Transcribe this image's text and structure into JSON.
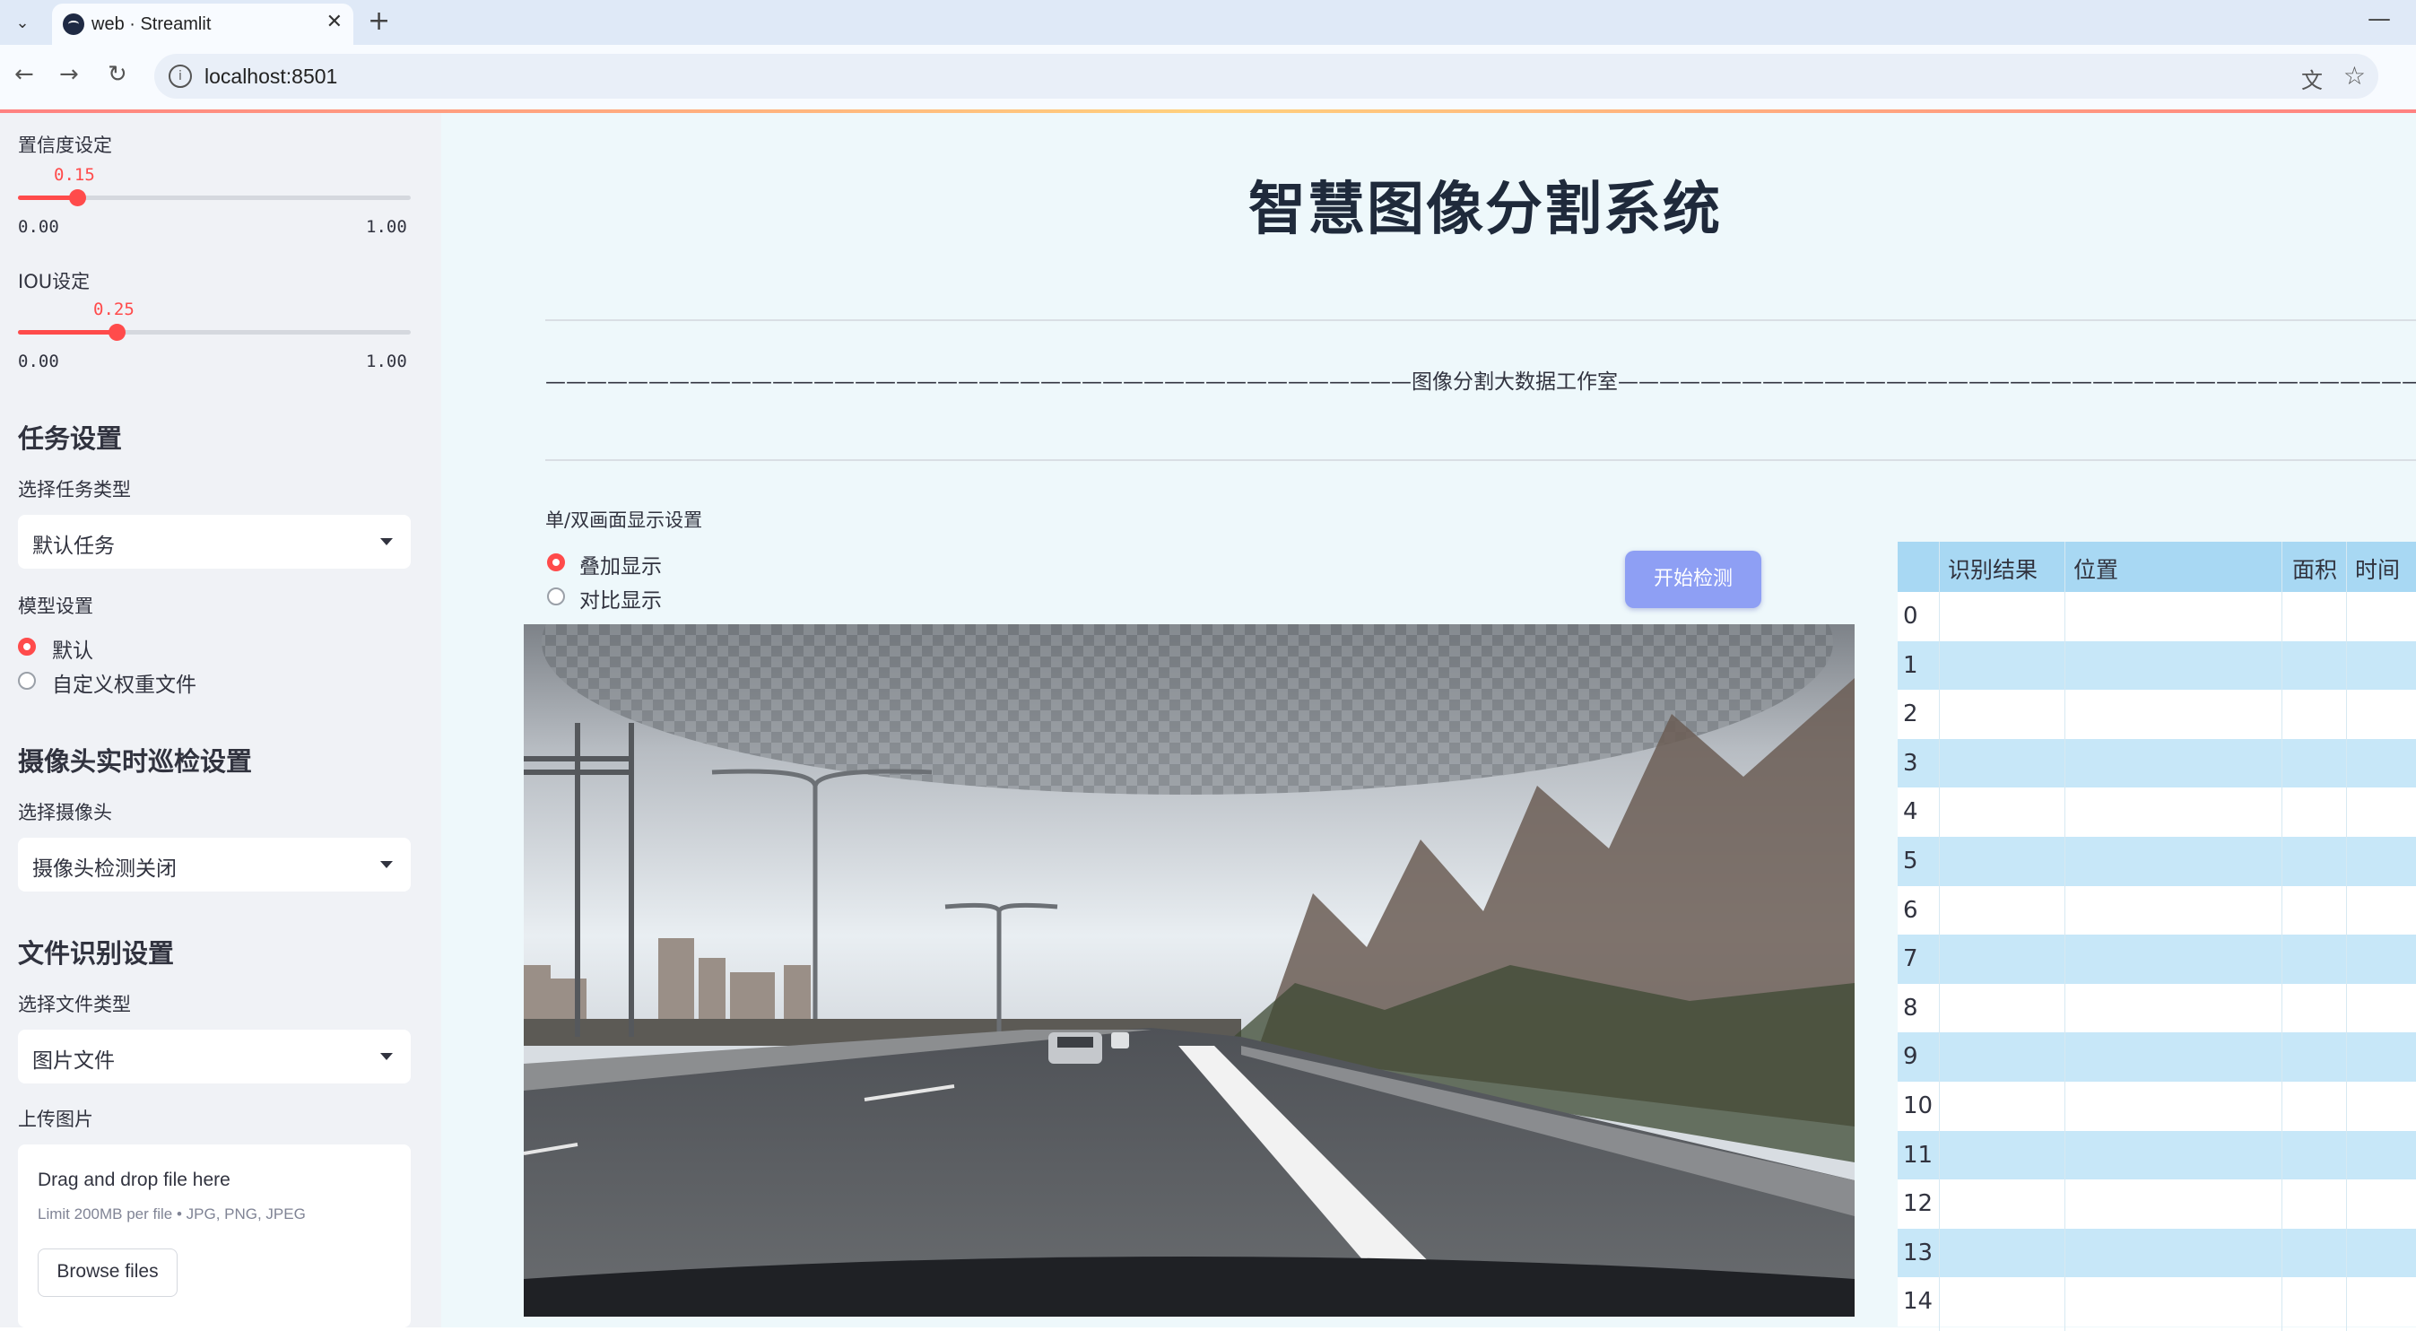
{
  "browser": {
    "tab_title": "web · Streamlit",
    "url": "localhost:8501"
  },
  "sidebar": {
    "confidence": {
      "label": "置信度设定",
      "value": "0.15",
      "value_fraction": 0.15,
      "min": "0.00",
      "max": "1.00"
    },
    "iou": {
      "label": "IOU设定",
      "value": "0.25",
      "value_fraction": 0.25,
      "min": "0.00",
      "max": "1.00"
    },
    "task": {
      "heading": "任务设置",
      "label": "选择任务类型",
      "selected": "默认任务"
    },
    "model": {
      "label": "模型设置",
      "options": [
        "默认",
        "自定义权重文件"
      ],
      "selected_index": 0
    },
    "camera": {
      "heading": "摄像头实时巡检设置",
      "label": "选择摄像头",
      "selected": "摄像头检测关闭"
    },
    "file": {
      "heading": "文件识别设置",
      "label": "选择文件类型",
      "selected": "图片文件",
      "upload_label": "上传图片"
    },
    "upload": {
      "title": "Drag and drop file here",
      "limit": "Limit 200MB per file • JPG, PNG, JPEG",
      "button": "Browse files"
    }
  },
  "main": {
    "title": "智慧图像分割系统",
    "subtitle_line": "——————————————————————————————————————————图像分割大数据工作室——————————————————————————————————————————",
    "display_mode": {
      "label": "单/双画面显示设置",
      "options": [
        "叠加显示",
        "对比显示"
      ],
      "selected_index": 0
    },
    "start_button": "开始检测",
    "results_table": {
      "columns": [
        "识别结果",
        "位置",
        "面积",
        "时间"
      ],
      "row_indices": [
        "0",
        "1",
        "2",
        "3",
        "4",
        "5",
        "6",
        "7",
        "8",
        "9",
        "10",
        "11",
        "12",
        "13",
        "14"
      ]
    }
  },
  "colors": {
    "accent": "#ff4b4b",
    "button": "#8e9ff4",
    "table_header": "#a8d8f3",
    "table_stripe": "#c7e7f8"
  },
  "icons": [
    "chevron-down-icon",
    "streamlit-favicon",
    "close-icon",
    "plus-icon",
    "minimize-icon",
    "back-icon",
    "forward-icon",
    "reload-icon",
    "info-icon",
    "translate-icon",
    "star-icon"
  ]
}
